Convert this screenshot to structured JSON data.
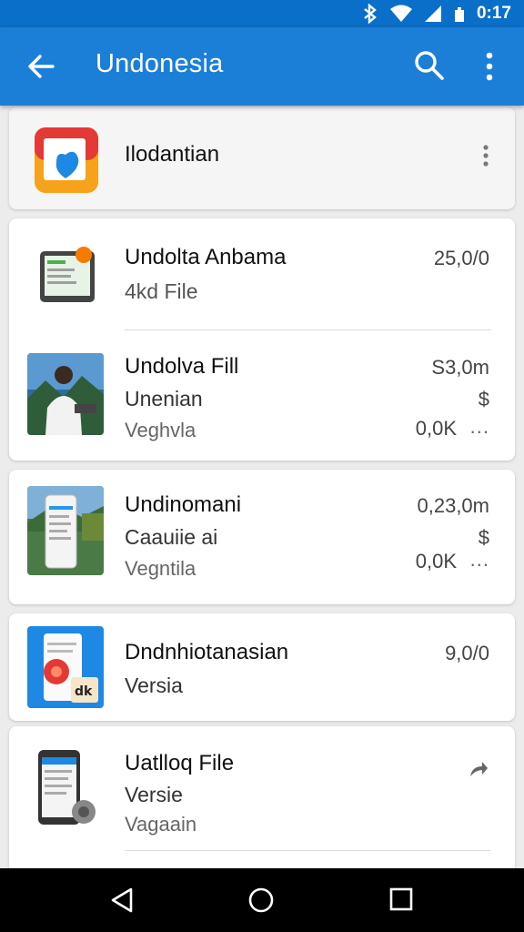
{
  "status_bar": {
    "time": "0:17"
  },
  "app_bar": {
    "title": "Undonesia"
  },
  "top_item": {
    "title": "Ilodantian"
  },
  "items": [
    {
      "title": "Undolta Anbama",
      "subtitle": "4kd File",
      "meta1": "25,0/0"
    },
    {
      "title": "Undolva Fill",
      "subtitle": "Unenian",
      "detail": "Veghvla",
      "meta1": "S3,0m",
      "meta2": "$",
      "meta3": "0,0K",
      "dots": "..."
    },
    {
      "title": "Undinomani",
      "subtitle": "Caauiie ai",
      "detail": "Vegntila",
      "meta1": "0,23,0m",
      "meta2": "$",
      "meta3": "0,0K",
      "dots": "..."
    },
    {
      "title": "Dndnhiotanasian",
      "subtitle": "Versia",
      "meta1": "9,0/0"
    },
    {
      "title": "Uatlloq File",
      "subtitle": "Versie",
      "detail": "Vagaain"
    }
  ],
  "colors": {
    "app_bar": "#1b7fd8",
    "status_bar": "#0a6fc9",
    "nav_bar": "#000000"
  }
}
